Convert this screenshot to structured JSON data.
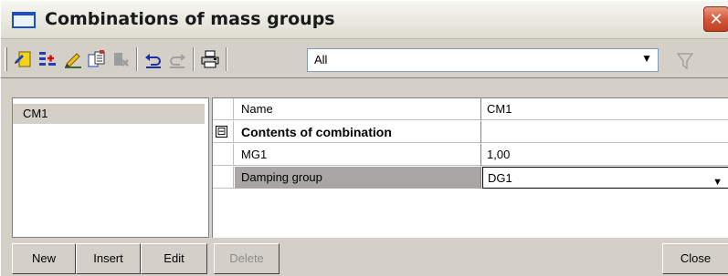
{
  "window": {
    "title": "Combinations of mass groups",
    "close_glyph": "✕"
  },
  "toolbar": {
    "icons": [
      "new-item-icon",
      "insert-icon",
      "edit-pencil-icon",
      "copy-icon",
      "clear-icon",
      "undo-icon",
      "redo-icon",
      "print-icon",
      "filter-icon"
    ],
    "filter_value": "All"
  },
  "list": {
    "items": [
      {
        "label": "CM1",
        "selected": true
      }
    ]
  },
  "properties": {
    "rows": [
      {
        "key": "Name",
        "value": "CM1"
      },
      {
        "key": "Contents of combination",
        "value": "",
        "expander": "⊟"
      },
      {
        "key": "MG1",
        "value": "1,00"
      },
      {
        "key": "Damping group",
        "value": "DG1"
      }
    ]
  },
  "buttons": {
    "new": "New",
    "insert": "Insert",
    "edit": "Edit",
    "delete": "Delete",
    "close": "Close"
  },
  "colors": {
    "accent_blue": "#1c4fbf",
    "close_red": "#d5573a",
    "face": "#d4d0c8"
  }
}
